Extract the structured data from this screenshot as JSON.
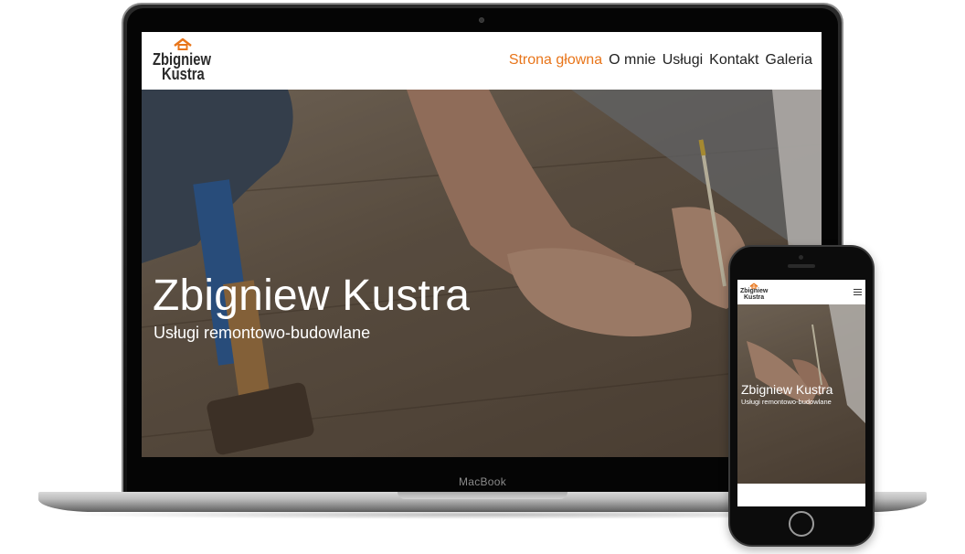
{
  "site": {
    "logo_line1": "Zbigniew",
    "logo_line2": "Kustra",
    "nav": [
      {
        "label": "Strona głowna",
        "active": true
      },
      {
        "label": "O mnie",
        "active": false
      },
      {
        "label": "Usługi",
        "active": false
      },
      {
        "label": "Kontakt",
        "active": false
      },
      {
        "label": "Galeria",
        "active": false
      }
    ],
    "hero_title": "Zbigniew Kustra",
    "hero_subtitle": "Usługi remontowo-budowlane"
  },
  "device": {
    "laptop_label": "MacBook"
  },
  "colors": {
    "accent": "#e8751a",
    "text_dark": "#222222",
    "hero_text": "#ffffff"
  },
  "icons": {
    "logo_mark": "house-roof-icon",
    "mobile_menu": "hamburger-menu-icon"
  }
}
